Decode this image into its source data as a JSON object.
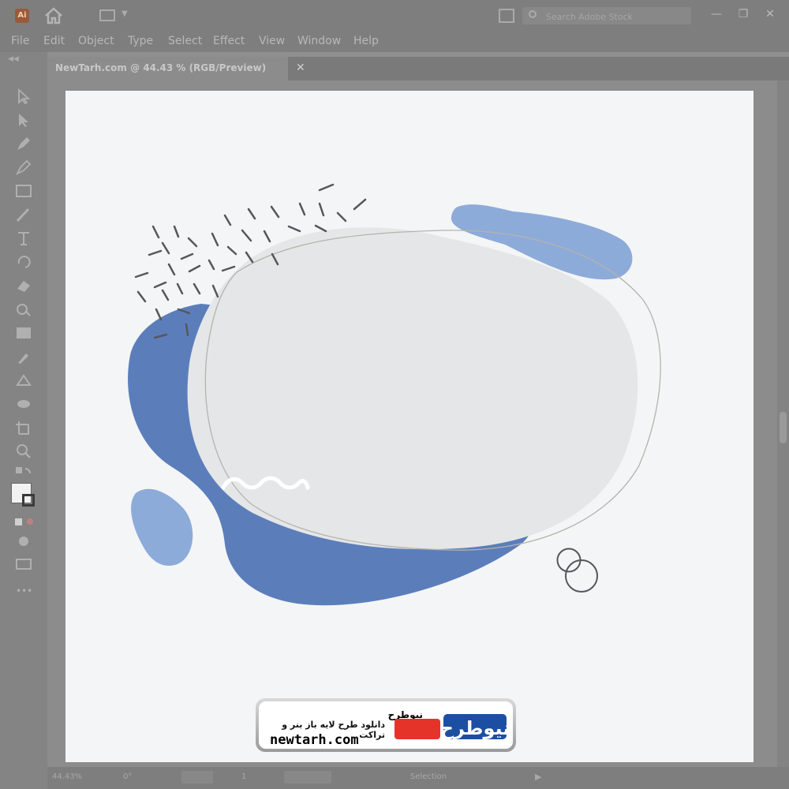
{
  "app": {
    "logo_text": "Ai"
  },
  "titlebar": {
    "search_placeholder": "Search Adobe Stock"
  },
  "menu": [
    "File",
    "Edit",
    "Object",
    "Type",
    "Select",
    "Effect",
    "View",
    "Window",
    "Help"
  ],
  "document": {
    "tab_label": "NewTarh.com @ 44.43 % (RGB/Preview)"
  },
  "status": {
    "zoom": "44.43%",
    "angle": "0°",
    "page": "1",
    "tool": "Selection"
  },
  "watermark": {
    "title_fa": "نیوطرح",
    "subtitle_fa": "دانلود طرح لایه باز بنر و تراکت",
    "site": "newtarh.com",
    "logo_fa": "نیوطرح"
  },
  "colors": {
    "dark_blue": "#5b7ebb",
    "light_blue": "#8dabd9",
    "light_gray": "#e5e6e7",
    "artboard": "#f4f5f6",
    "logo_red": "#e6332a",
    "logo_blue": "#1c4fa1"
  }
}
